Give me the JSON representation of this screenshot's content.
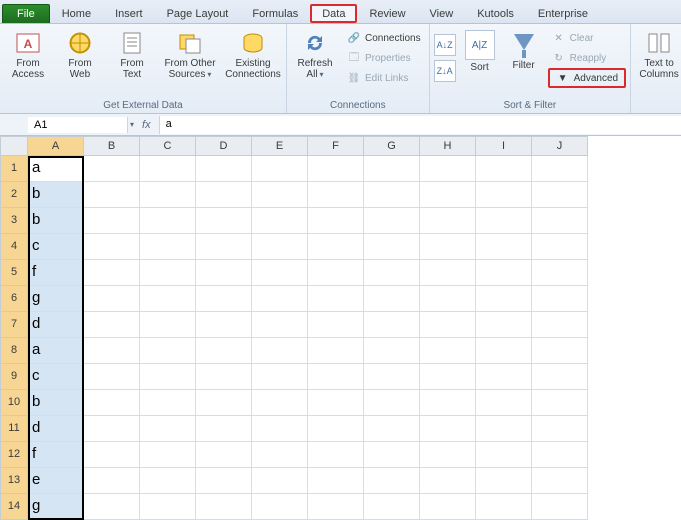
{
  "tabs": {
    "file": "File",
    "items": [
      "Home",
      "Insert",
      "Page Layout",
      "Formulas",
      "Data",
      "Review",
      "View",
      "Kutools",
      "Enterprise"
    ],
    "active": "Data"
  },
  "ribbon": {
    "get_external": {
      "title": "Get External Data",
      "from_access": "From\nAccess",
      "from_web": "From\nWeb",
      "from_text": "From\nText",
      "from_other": "From Other\nSources",
      "existing": "Existing\nConnections"
    },
    "connections": {
      "title": "Connections",
      "refresh": "Refresh\nAll",
      "conn": "Connections",
      "props": "Properties",
      "edit": "Edit Links"
    },
    "sortfilter": {
      "title": "Sort & Filter",
      "sort": "Sort",
      "filter": "Filter",
      "clear": "Clear",
      "reapply": "Reapply",
      "advanced": "Advanced"
    },
    "datatools": {
      "texttocols": "Text to\nColumns"
    }
  },
  "formula_bar": {
    "name_box": "A1",
    "fx": "fx",
    "value": "a"
  },
  "grid": {
    "columns": [
      "A",
      "B",
      "C",
      "D",
      "E",
      "F",
      "G",
      "H",
      "I",
      "J"
    ],
    "rows": [
      {
        "n": 1,
        "a": "a"
      },
      {
        "n": 2,
        "a": "b"
      },
      {
        "n": 3,
        "a": "b"
      },
      {
        "n": 4,
        "a": "c"
      },
      {
        "n": 5,
        "a": "f"
      },
      {
        "n": 6,
        "a": "g"
      },
      {
        "n": 7,
        "a": "d"
      },
      {
        "n": 8,
        "a": "a"
      },
      {
        "n": 9,
        "a": "c"
      },
      {
        "n": 10,
        "a": "b"
      },
      {
        "n": 11,
        "a": "d"
      },
      {
        "n": 12,
        "a": "f"
      },
      {
        "n": 13,
        "a": "e"
      },
      {
        "n": 14,
        "a": "g"
      }
    ],
    "selected_col": "A",
    "active_cell": "A1"
  }
}
